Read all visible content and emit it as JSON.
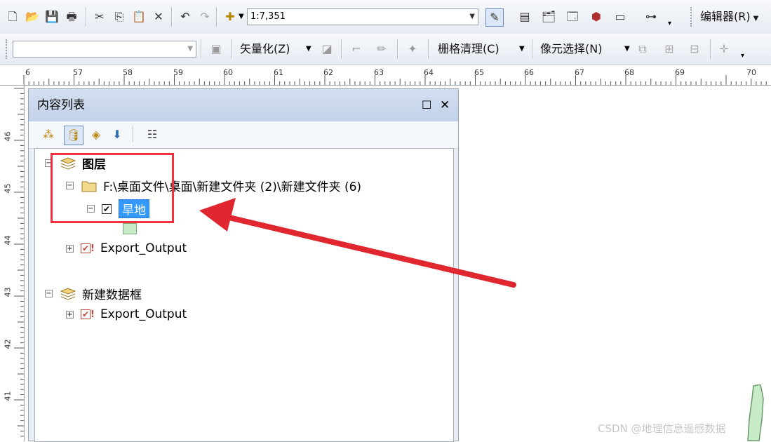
{
  "toolbar1": {
    "scale_value": "1:7,351",
    "editor_label": "编辑器(R)"
  },
  "toolbar2": {
    "vectorize_label": "矢量化(Z)",
    "raster_cleanup_label": "栅格清理(C)",
    "cell_select_label": "像元选择(N)"
  },
  "ruler": {
    "h_ticks": [
      "6",
      "57",
      "58",
      "59",
      "60",
      "61",
      "62",
      "63",
      "64",
      "65",
      "66",
      "67",
      "68",
      "69",
      "70"
    ],
    "v_ticks": [
      "46",
      "45",
      "44",
      "43",
      "42",
      "41"
    ]
  },
  "toc": {
    "title": "内容列表",
    "tree": {
      "frame1_label": "图层",
      "folder_label": "F:\\桌面文件\\桌面\\新建文件夹 (2)\\新建文件夹 (6)",
      "layer_label": "旱地",
      "export1_label": "Export_Output",
      "frame2_label": "新建数据框",
      "export2_label": "Export_Output"
    }
  },
  "watermark": "CSDN @地理信息遥感数据",
  "colors": {
    "highlight": "#f2323c",
    "arrow": "#e0262e",
    "selection": "#3399ff",
    "swatch": "#c8ecc8"
  }
}
